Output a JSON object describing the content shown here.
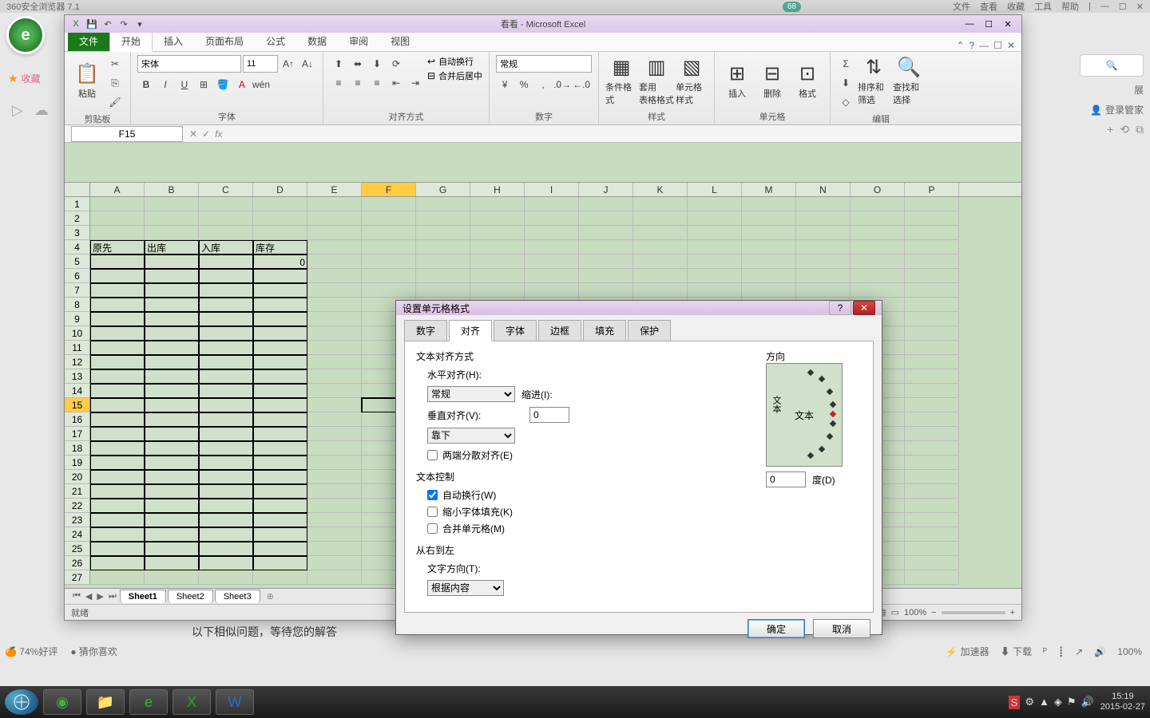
{
  "browser": {
    "title": "360安全浏览器 7.1",
    "badge": "68",
    "menu": [
      "文件",
      "查看",
      "收藏",
      "工具",
      "帮助"
    ],
    "fav_label": "收藏",
    "ext_label": "展",
    "login_label": "登录管家"
  },
  "excel": {
    "title": "看看 - Microsoft Excel",
    "tabs": {
      "file": "文件",
      "items": [
        "开始",
        "插入",
        "页面布局",
        "公式",
        "数据",
        "审阅",
        "视图"
      ],
      "active": "开始"
    },
    "ribbon": {
      "clipboard": {
        "label": "剪贴板",
        "paste": "粘贴"
      },
      "font": {
        "label": "字体",
        "name": "宋体",
        "size": "11"
      },
      "align": {
        "label": "对齐方式",
        "wrap": "自动换行",
        "merge": "合并后居中"
      },
      "number": {
        "label": "数字",
        "format": "常规"
      },
      "styles": {
        "label": "样式",
        "cond": "条件格式",
        "table": "套用\n表格格式",
        "cell": "单元格样式"
      },
      "cells": {
        "label": "单元格",
        "insert": "插入",
        "delete": "删除",
        "format": "格式"
      },
      "editing": {
        "label": "编辑",
        "sort": "排序和筛选",
        "find": "查找和选择"
      }
    },
    "namebox": "F15",
    "columns": [
      "A",
      "B",
      "C",
      "D",
      "E",
      "F",
      "G",
      "H",
      "I",
      "J",
      "K",
      "L",
      "M",
      "N",
      "O",
      "P"
    ],
    "active_col": "F",
    "active_row": 15,
    "data": {
      "r4": {
        "A": "原先",
        "B": "出库",
        "C": "入库",
        "D": "库存"
      },
      "r5": {
        "D": "0"
      }
    },
    "sheets": [
      "Sheet1",
      "Sheet2",
      "Sheet3"
    ],
    "status": "就绪",
    "zoom": "100%"
  },
  "dialog": {
    "title": "设置单元格格式",
    "tabs": [
      "数字",
      "对齐",
      "字体",
      "边框",
      "填充",
      "保护"
    ],
    "active_tab": "对齐",
    "sections": {
      "text_align": "文本对齐方式",
      "h_align_label": "水平对齐(H):",
      "h_align_value": "常规",
      "indent_label": "缩进(I):",
      "indent_value": "0",
      "v_align_label": "垂直对齐(V):",
      "v_align_value": "靠下",
      "justify": "两端分散对齐(E)",
      "text_control": "文本控制",
      "wrap": "自动换行(W)",
      "shrink": "缩小字体填充(K)",
      "merge": "合并单元格(M)",
      "rtl": "从右到左",
      "text_dir_label": "文字方向(T):",
      "text_dir_value": "根据内容",
      "orientation": "方向",
      "orient_text_v": "文本",
      "orient_text_h": "文本",
      "degree_value": "0",
      "degree_label": "度(D)"
    },
    "ok": "确定",
    "cancel": "取消"
  },
  "page": {
    "bottom_text": "以下相似问题，等待您的解答",
    "rating": "74%好评",
    "guess": "猜你喜欢",
    "accel": "加速器",
    "download": "下载"
  },
  "taskbar": {
    "time": "15:19",
    "date": "2015-02-27"
  }
}
